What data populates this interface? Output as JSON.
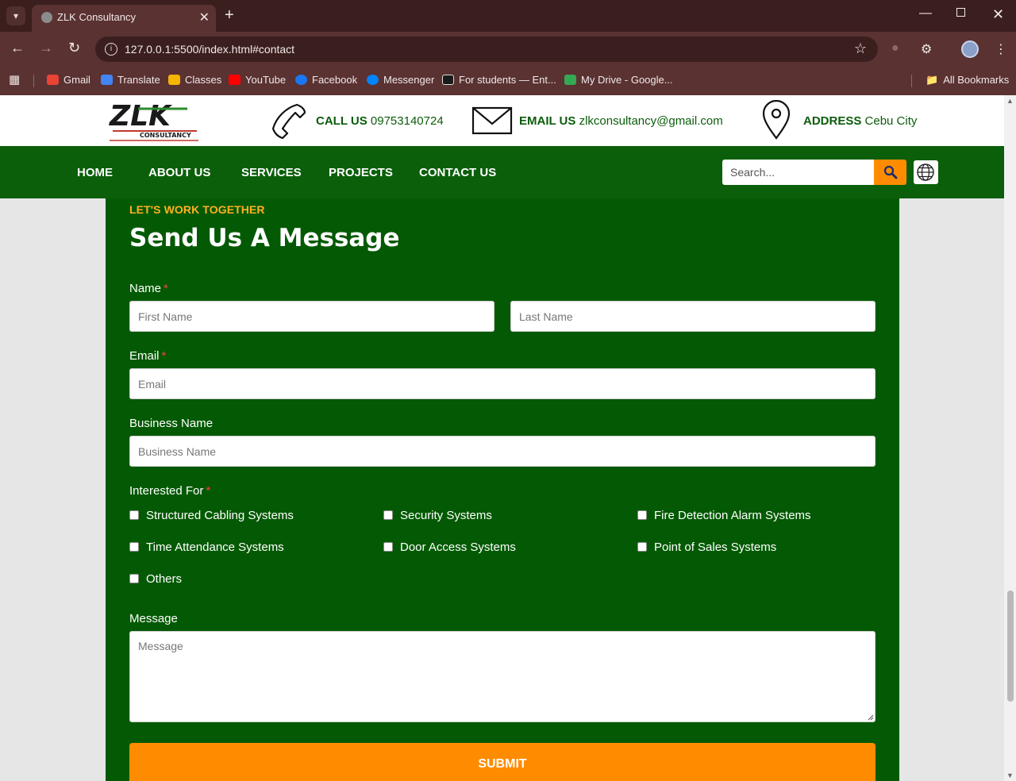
{
  "browser": {
    "tab_title": "ZLK Consultancy",
    "url": "127.0.0.1:5500/index.html#contact",
    "bookmarks": [
      {
        "label": "Gmail",
        "color": "#ea4335"
      },
      {
        "label": "Translate",
        "color": "#4285f4"
      },
      {
        "label": "Classes",
        "color": "#f4b400"
      },
      {
        "label": "YouTube",
        "color": "#ff0000"
      },
      {
        "label": "Facebook",
        "color": "#1877f2"
      },
      {
        "label": "Messenger",
        "color": "#0084ff"
      },
      {
        "label": "For students — Ent...",
        "color": "#1a1a1a"
      },
      {
        "label": "My Drive - Google...",
        "color": "#34a853"
      }
    ],
    "all_bookmarks": "All Bookmarks"
  },
  "header": {
    "logo_text": "ZLK",
    "logo_sub": "CONSULTANCY",
    "call_label": "CALL US",
    "call_value": "09753140724",
    "email_label": "EMAIL US",
    "email_value": "zlkconsultancy@gmail.com",
    "address_label": "ADDRESS",
    "address_value": "Cebu City"
  },
  "nav": {
    "items": [
      "HOME",
      "ABOUT US",
      "SERVICES",
      "PROJECTS",
      "CONTACT US"
    ],
    "search_placeholder": "Search..."
  },
  "form": {
    "eyebrow": "LET'S WORK TOGETHER",
    "title": "Send Us A Message",
    "name_label": "Name",
    "first_name_placeholder": "First Name",
    "last_name_placeholder": "Last Name",
    "email_label": "Email",
    "email_placeholder": "Email",
    "business_label": "Business Name",
    "business_placeholder": "Business Name",
    "interest_label": "Interested For",
    "interests": [
      "Structured Cabling Systems",
      "Security Systems",
      "Fire Detection Alarm Systems",
      "Time Attendance Systems",
      "Door Access Systems",
      "Point of Sales Systems",
      "Others"
    ],
    "message_label": "Message",
    "message_placeholder": "Message",
    "submit_label": "SUBMIT",
    "required_mark": "*"
  },
  "colors": {
    "brand_green": "#045a04",
    "nav_green": "#0b5f0b",
    "accent_orange": "#ff8c00",
    "eyebrow_orange": "#ffb020"
  }
}
